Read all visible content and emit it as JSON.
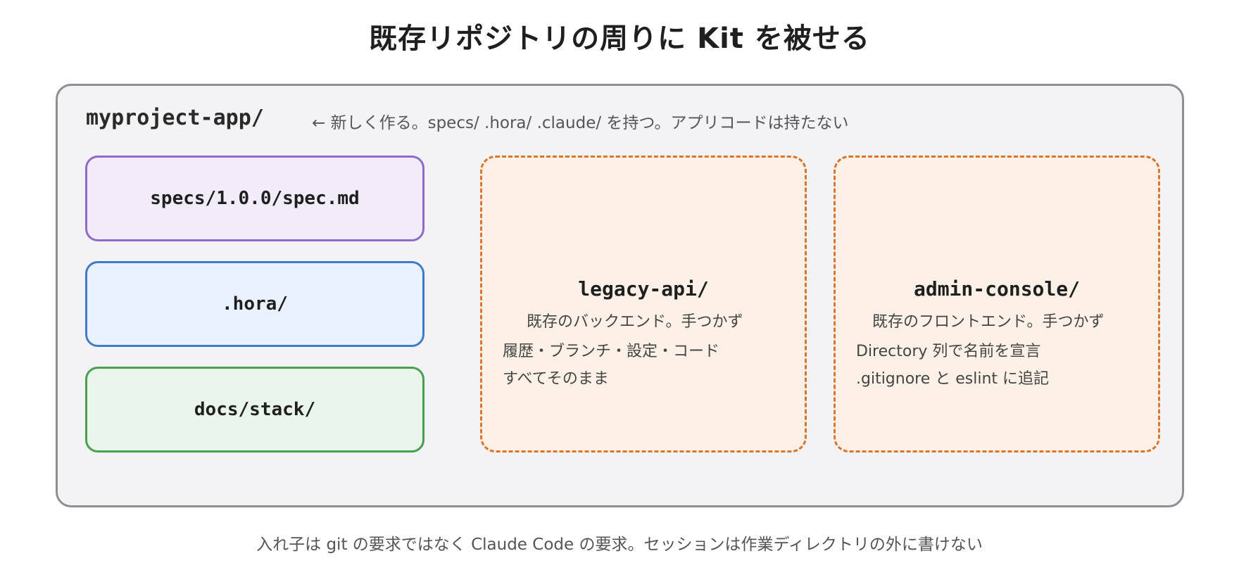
{
  "title": "既存リポジトリの周りに Kit を被せる",
  "root": {
    "name": "myproject-app/",
    "note": "← 新しく作る。specs/ .hora/ .claude/ を持つ。アプリコードは持たない"
  },
  "kit_dirs": [
    {
      "name": "specs/1.0.0/spec.md",
      "color": "#8e6bc6"
    },
    {
      "name": ".hora/",
      "color": "#3c7cc9"
    },
    {
      "name": "docs/stack/",
      "color": "#46a050"
    }
  ],
  "existing_repos": [
    {
      "name": "legacy-api/",
      "lines": [
        "既存のバックエンド。手つかず",
        "履歴・ブランチ・設定・コード",
        "すべてそのまま"
      ]
    },
    {
      "name": "admin-console/",
      "lines": [
        "既存のフロントエンド。手つかず",
        "Directory 列で名前を宣言",
        ".gitignore と eslint に追記"
      ]
    }
  ],
  "existing_color": "#d9752e",
  "footer": "入れ子は git の要求ではなく Claude Code の要求。セッションは作業ディレクトリの外に書けない"
}
